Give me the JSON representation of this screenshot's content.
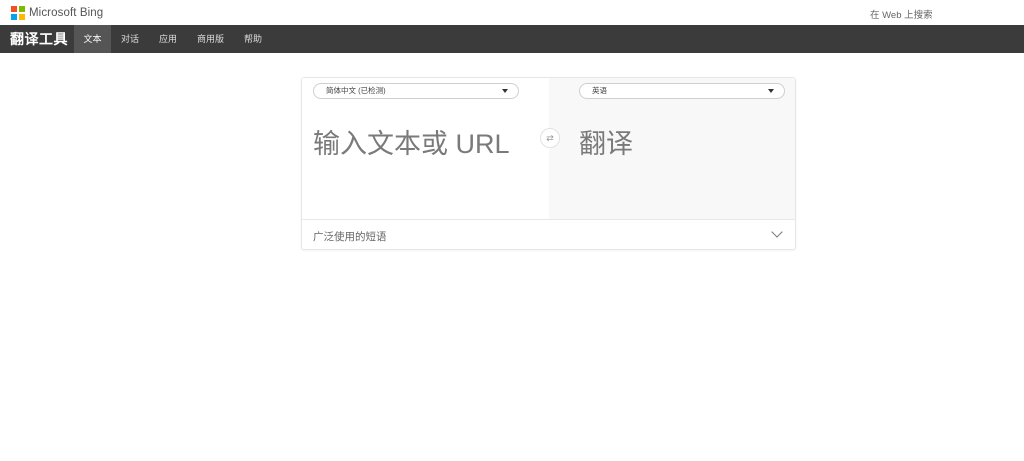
{
  "brand": {
    "name": "Microsoft Bing",
    "logo_colors": [
      "#f25022",
      "#7fba00",
      "#00a4ef",
      "#ffb900"
    ],
    "web_search": "在 Web 上搜索"
  },
  "nav": {
    "title": "翻译工具",
    "tabs": [
      {
        "label": "文本",
        "active": true
      },
      {
        "label": "对话",
        "active": false
      },
      {
        "label": "应用",
        "active": false
      },
      {
        "label": "商用版",
        "active": false
      },
      {
        "label": "帮助",
        "active": false
      }
    ]
  },
  "translator": {
    "from_language": "简体中文 (已检测)",
    "to_language": "英语",
    "input_placeholder": "输入文本或 URL",
    "output_placeholder": "翻译",
    "swap_icon": "⇄",
    "phrases_label": "广泛使用的短语"
  }
}
